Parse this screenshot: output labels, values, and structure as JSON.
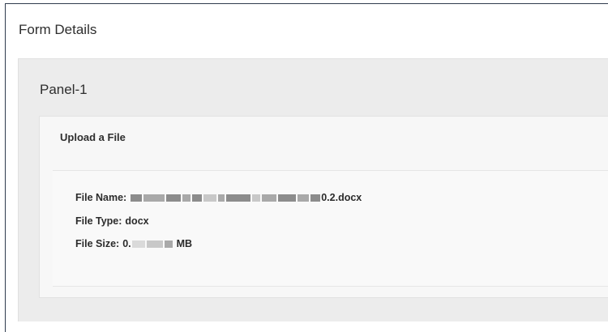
{
  "form": {
    "title": "Form Details"
  },
  "panel": {
    "title": "Panel-1"
  },
  "upload": {
    "title": "Upload a File",
    "file_name_label": "File Name:",
    "file_name_suffix": "0.2.docx",
    "file_type_label": "File Type:",
    "file_type_value": "docx",
    "file_size_label": "File Size:",
    "file_size_prefix": "0.",
    "file_size_unit": "MB"
  },
  "colors": {
    "frame_border": "#2f3b4d",
    "panel_bg": "#ececec",
    "box_bg": "#f7f7f7",
    "text": "#2e2e2e",
    "redaction": "#8c8c8c"
  }
}
